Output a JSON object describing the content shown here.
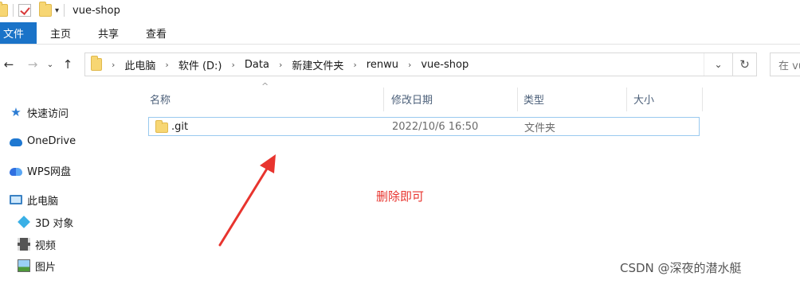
{
  "window": {
    "title": "vue-shop"
  },
  "ribbon": {
    "tabs": [
      "文件",
      "主页",
      "共享",
      "查看"
    ]
  },
  "address": {
    "crumbs": [
      "此电脑",
      "软件 (D:)",
      "Data",
      "新建文件夹",
      "renwu",
      "vue-shop"
    ],
    "search_placeholder": "在 vue-shop 中搜索"
  },
  "sidebar": {
    "items": [
      {
        "label": "快速访问",
        "icon": "star-icon"
      },
      {
        "label": "OneDrive",
        "icon": "onedrive-cloud-icon"
      },
      {
        "label": "WPS网盘",
        "icon": "wps-cloud-icon"
      },
      {
        "label": "此电脑",
        "icon": "computer-icon"
      },
      {
        "label": "3D 对象",
        "icon": "cube-icon"
      },
      {
        "label": "视频",
        "icon": "video-icon"
      },
      {
        "label": "图片",
        "icon": "picture-icon"
      }
    ]
  },
  "columns": {
    "name": "名称",
    "modified": "修改日期",
    "type": "类型",
    "size": "大小"
  },
  "files": [
    {
      "name": ".git",
      "modified": "2022/10/6 16:50",
      "type": "文件夹",
      "size": ""
    }
  ],
  "annotation": {
    "text": "删除即可",
    "color": "#e8342e"
  },
  "watermark": "CSDN @深夜的潜水艇",
  "colors": {
    "accent": "#1a73c8",
    "selection_border": "#99c9ef"
  }
}
